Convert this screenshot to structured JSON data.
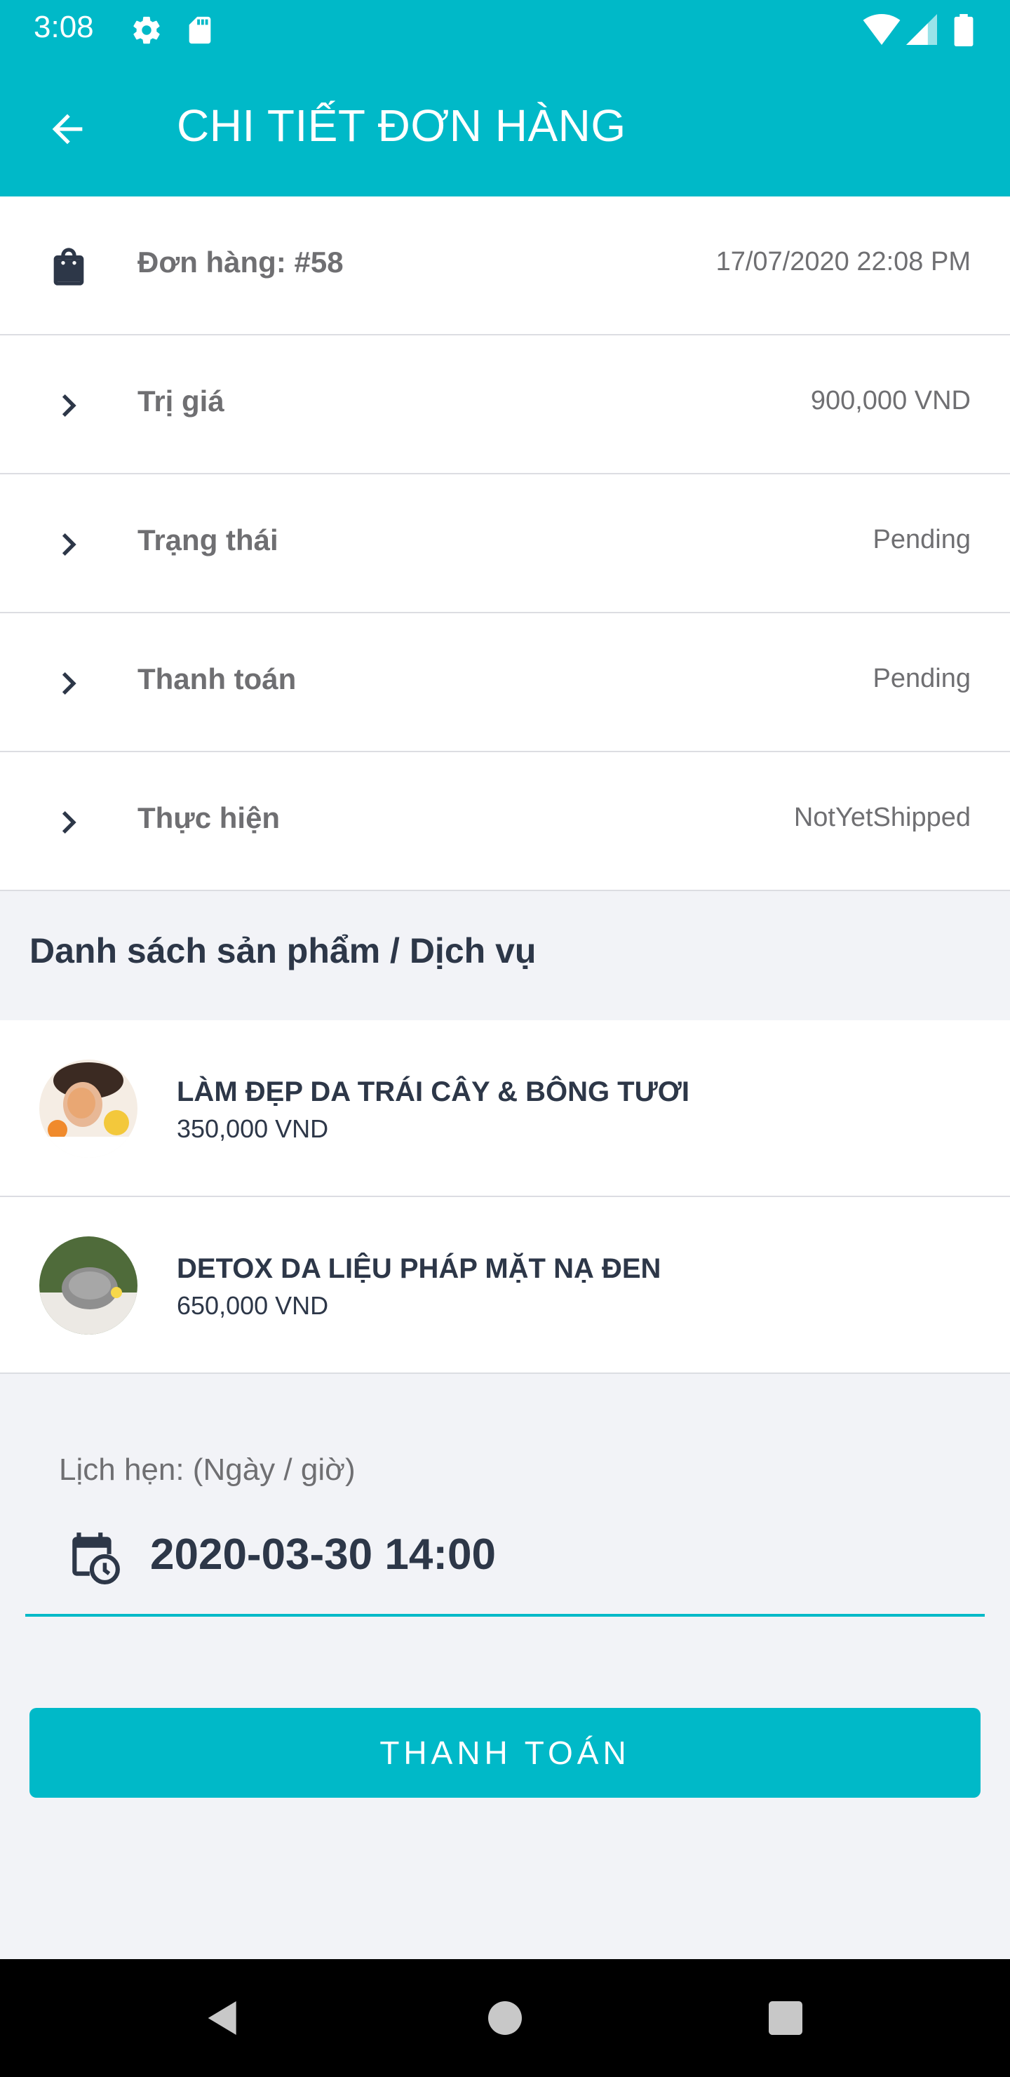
{
  "status_bar": {
    "time": "3:08",
    "icons": [
      "settings-icon",
      "sd-card-icon",
      "wifi-icon",
      "signal-icon",
      "battery-icon"
    ]
  },
  "app_bar": {
    "title": "CHI TIẾT ĐƠN HÀNG",
    "back_icon": "arrow-back-icon"
  },
  "order": {
    "label": "Đơn hàng: #58",
    "date": "17/07/2020 22:08 PM"
  },
  "details": [
    {
      "label": "Trị giá",
      "value": "900,000 VND"
    },
    {
      "label": "Trạng thái",
      "value": "Pending"
    },
    {
      "label": "Thanh toán",
      "value": "Pending"
    },
    {
      "label": "Thực hiện",
      "value": "NotYetShipped"
    }
  ],
  "products_section": {
    "title": "Danh sách sản phẩm / Dịch vụ",
    "items": [
      {
        "name": "LÀM ĐẸP DA TRÁI CÂY & BÔNG TƯƠI",
        "price": "350,000 VND"
      },
      {
        "name": "DETOX DA LIỆU PHÁP MẶT NẠ ĐEN",
        "price": "650,000 VND"
      }
    ]
  },
  "appointment": {
    "label": "Lịch hẹn: (Ngày / giờ)",
    "value": "2020-03-30 14:00"
  },
  "pay_button": {
    "label": "THANH TOÁN"
  },
  "colors": {
    "accent": "#00b9c8",
    "text_dark": "#2d3748",
    "text_muted": "#6f6f72",
    "background": "#f2f3f7"
  }
}
